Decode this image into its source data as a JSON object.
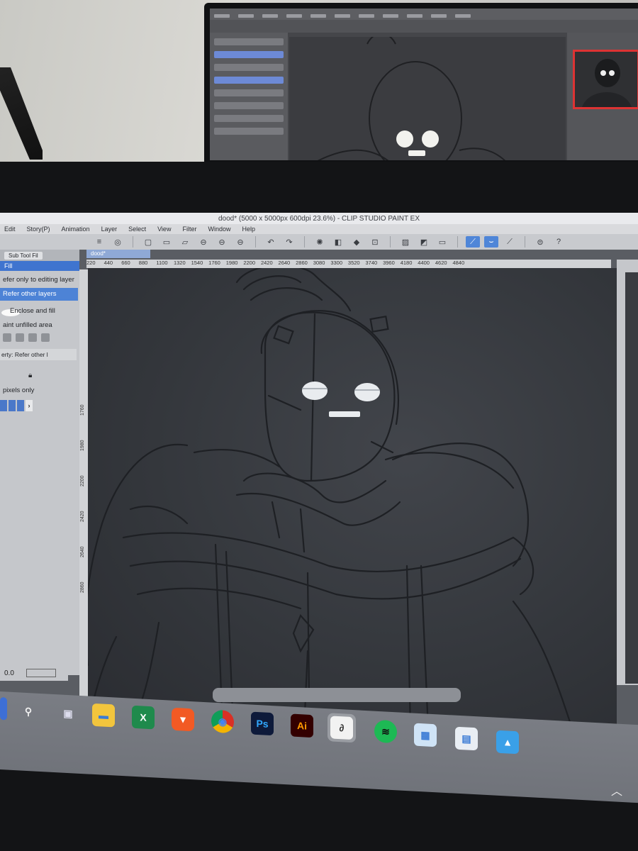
{
  "background_monitor": {
    "app": "CLIP STUDIO PAINT"
  },
  "window": {
    "title": "dood* (5000 x 5000px 600dpi 23.6%) - CLIP STUDIO PAINT EX"
  },
  "menu": [
    "Edit",
    "Story(P)",
    "Animation",
    "Layer",
    "Select",
    "View",
    "Filter",
    "Window",
    "Help"
  ],
  "tool_panel": {
    "subtool_tab": "Sub Tool Fil",
    "section": "Fill",
    "options": [
      {
        "label": "efer only to editing layer",
        "selected": false
      },
      {
        "label": "Refer other layers",
        "selected": true
      },
      {
        "label": "Enclose and fill",
        "selected": false
      },
      {
        "label": "aint unfilled area",
        "selected": false
      }
    ],
    "property_line": "erty: Refer other l",
    "pixels_only": "pixels only"
  },
  "document": {
    "tab_label": "dood*",
    "ruler_h": [
      "220",
      "440",
      "660",
      "880",
      "1100",
      "1320",
      "1540",
      "1760",
      "1980",
      "2200",
      "2420",
      "2640",
      "2860",
      "3080",
      "3300",
      "3520",
      "3740",
      "3960",
      "4180",
      "4400",
      "4620",
      "4840"
    ],
    "ruler_v": [
      "1760",
      "1980",
      "2200",
      "2420",
      "2640",
      "2860"
    ]
  },
  "status": {
    "zoom": "0.0"
  },
  "taskbar": {
    "apps": [
      {
        "name": "search",
        "glyph": "⚲",
        "color": "#e6e6e6"
      },
      {
        "name": "task-view",
        "glyph": "▣",
        "color": "#d0d4da"
      },
      {
        "name": "file-explorer",
        "glyph": "▬",
        "color": "#f2c53d"
      },
      {
        "name": "excel",
        "glyph": "X",
        "color": "#1f8a4c"
      },
      {
        "name": "brave",
        "glyph": "▼",
        "color": "#f25a24"
      },
      {
        "name": "chrome",
        "glyph": "◉",
        "color": "#e8b21a"
      },
      {
        "name": "photoshop",
        "glyph": "Ps",
        "color": "#0e1a3a"
      },
      {
        "name": "illustrator",
        "glyph": "Ai",
        "color": "#3a1a08"
      },
      {
        "name": "clip-studio",
        "glyph": "∂",
        "color": "#f2f2f2"
      },
      {
        "name": "spotify",
        "glyph": "≋",
        "color": "#1db954"
      },
      {
        "name": "calculator",
        "glyph": "▦",
        "color": "#cfe3f6"
      },
      {
        "name": "notepad",
        "glyph": "▤",
        "color": "#e9eef4"
      },
      {
        "name": "photos",
        "glyph": "▲",
        "color": "#3aa0e8"
      }
    ]
  }
}
